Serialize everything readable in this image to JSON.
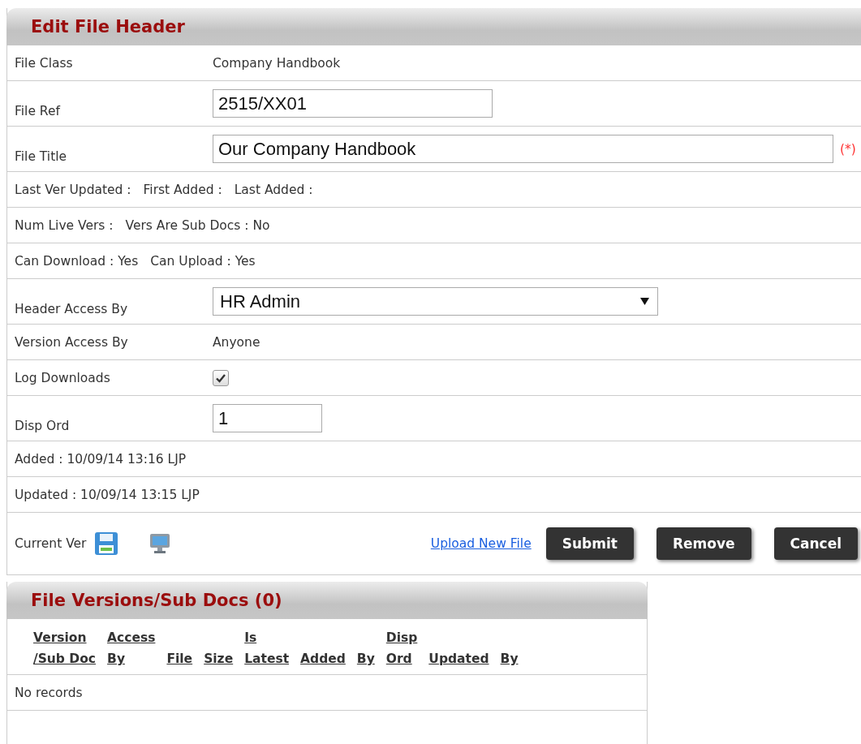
{
  "form": {
    "title": "Edit File Header",
    "rows": [
      {
        "kind": "text",
        "label": "File Class",
        "value": "Company Handbook"
      },
      {
        "kind": "input",
        "label": "File Ref",
        "value": "2515/XX01"
      },
      {
        "kind": "input",
        "label": "File Title",
        "value": "Our Company Handbook",
        "required_mark": "(*)"
      },
      {
        "kind": "info",
        "parts": [
          "Last Ver Updated :",
          "First Added :",
          "Last Added :"
        ]
      },
      {
        "kind": "info",
        "parts": [
          "Num Live Vers :",
          "Vers Are Sub Docs : No"
        ]
      },
      {
        "kind": "info",
        "parts": [
          "Can Download : Yes",
          "Can Upload : Yes"
        ]
      },
      {
        "kind": "select",
        "label": "Header Access By",
        "value": "HR Admin"
      },
      {
        "kind": "text",
        "label": "Version Access By",
        "value": "Anyone"
      },
      {
        "kind": "check",
        "label": "Log Downloads",
        "checked": true
      },
      {
        "kind": "input",
        "label": "Disp Ord",
        "value": "1"
      },
      {
        "kind": "info",
        "parts": [
          "Added : 10/09/14 13:16 LJP"
        ]
      },
      {
        "kind": "info",
        "parts": [
          "Updated : 10/09/14 13:15 LJP"
        ]
      }
    ],
    "actions": {
      "label": "Current Ver",
      "link": "Upload New File",
      "buttons": [
        "Submit",
        "Remove",
        "Cancel"
      ]
    }
  },
  "versions": {
    "title": "File Versions/Sub Docs (0)",
    "columns": [
      {
        "lines": [
          "Version",
          "/Sub Doc"
        ]
      },
      {
        "lines": [
          "Access",
          "By"
        ]
      },
      {
        "lines": [
          "File"
        ]
      },
      {
        "lines": [
          "Size"
        ]
      },
      {
        "lines": [
          "Is",
          "Latest"
        ]
      },
      {
        "lines": [
          "Added"
        ]
      },
      {
        "lines": [
          "By"
        ]
      },
      {
        "lines": [
          "Disp",
          "Ord"
        ]
      },
      {
        "lines": [
          "Updated"
        ]
      },
      {
        "lines": [
          "By"
        ]
      }
    ],
    "empty": "No records"
  }
}
